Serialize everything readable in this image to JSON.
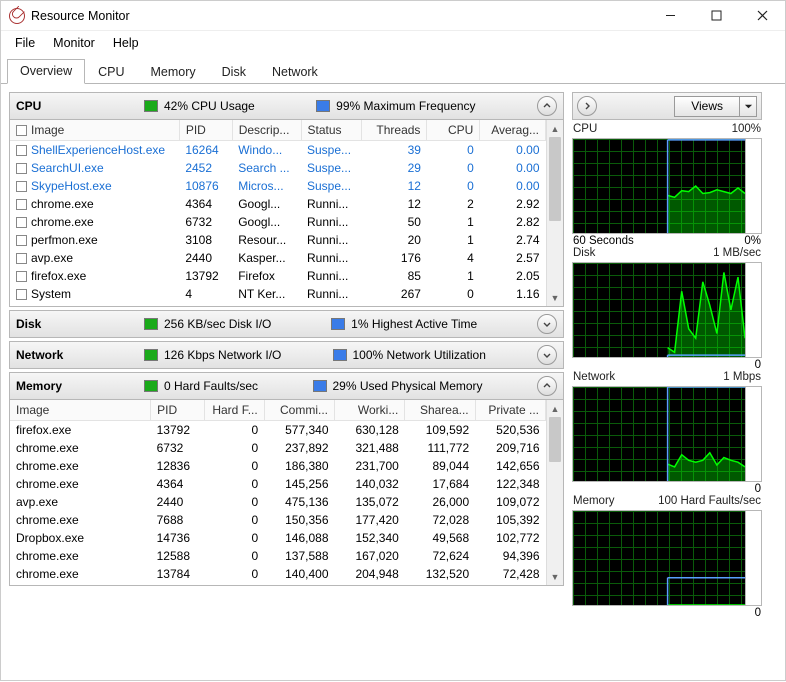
{
  "window": {
    "title": "Resource Monitor",
    "menu": [
      "File",
      "Monitor",
      "Help"
    ],
    "tabs": [
      "Overview",
      "CPU",
      "Memory",
      "Disk",
      "Network"
    ],
    "active_tab": 0,
    "views_label": "Views"
  },
  "sections": {
    "cpu": {
      "title": "CPU",
      "metric1": "42% CPU Usage",
      "metric2": "99% Maximum Frequency",
      "cols": [
        "Image",
        "PID",
        "Descrip...",
        "Status",
        "Threads",
        "CPU",
        "Averag..."
      ],
      "rows": [
        {
          "blue": true,
          "image": "ShellExperienceHost.exe",
          "pid": "16264",
          "desc": "Windo...",
          "status": "Suspe...",
          "threads": "39",
          "cpu": "0",
          "avg": "0.00"
        },
        {
          "blue": true,
          "image": "SearchUI.exe",
          "pid": "2452",
          "desc": "Search ...",
          "status": "Suspe...",
          "threads": "29",
          "cpu": "0",
          "avg": "0.00"
        },
        {
          "blue": true,
          "image": "SkypeHost.exe",
          "pid": "10876",
          "desc": "Micros...",
          "status": "Suspe...",
          "threads": "12",
          "cpu": "0",
          "avg": "0.00"
        },
        {
          "blue": false,
          "image": "chrome.exe",
          "pid": "4364",
          "desc": "Googl...",
          "status": "Runni...",
          "threads": "12",
          "cpu": "2",
          "avg": "2.92"
        },
        {
          "blue": false,
          "image": "chrome.exe",
          "pid": "6732",
          "desc": "Googl...",
          "status": "Runni...",
          "threads": "50",
          "cpu": "1",
          "avg": "2.82"
        },
        {
          "blue": false,
          "image": "perfmon.exe",
          "pid": "3108",
          "desc": "Resour...",
          "status": "Runni...",
          "threads": "20",
          "cpu": "1",
          "avg": "2.74"
        },
        {
          "blue": false,
          "image": "avp.exe",
          "pid": "2440",
          "desc": "Kasper...",
          "status": "Runni...",
          "threads": "176",
          "cpu": "4",
          "avg": "2.57"
        },
        {
          "blue": false,
          "image": "firefox.exe",
          "pid": "13792",
          "desc": "Firefox",
          "status": "Runni...",
          "threads": "85",
          "cpu": "1",
          "avg": "2.05"
        },
        {
          "blue": false,
          "image": "System",
          "pid": "4",
          "desc": "NT Ker...",
          "status": "Runni...",
          "threads": "267",
          "cpu": "0",
          "avg": "1.16"
        }
      ]
    },
    "disk": {
      "title": "Disk",
      "metric1": "256 KB/sec Disk I/O",
      "metric2": "1% Highest Active Time"
    },
    "network": {
      "title": "Network",
      "metric1": "126 Kbps Network I/O",
      "metric2": "100% Network Utilization"
    },
    "memory": {
      "title": "Memory",
      "metric1": "0 Hard Faults/sec",
      "metric2": "29% Used Physical Memory",
      "cols": [
        "Image",
        "PID",
        "Hard F...",
        "Commi...",
        "Worki...",
        "Sharea...",
        "Private ..."
      ],
      "rows": [
        {
          "image": "firefox.exe",
          "pid": "13792",
          "hf": "0",
          "commit": "577,340",
          "work": "630,128",
          "share": "109,592",
          "priv": "520,536"
        },
        {
          "image": "chrome.exe",
          "pid": "6732",
          "hf": "0",
          "commit": "237,892",
          "work": "321,488",
          "share": "111,772",
          "priv": "209,716"
        },
        {
          "image": "chrome.exe",
          "pid": "12836",
          "hf": "0",
          "commit": "186,380",
          "work": "231,700",
          "share": "89,044",
          "priv": "142,656"
        },
        {
          "image": "chrome.exe",
          "pid": "4364",
          "hf": "0",
          "commit": "145,256",
          "work": "140,032",
          "share": "17,684",
          "priv": "122,348"
        },
        {
          "image": "avp.exe",
          "pid": "2440",
          "hf": "0",
          "commit": "475,136",
          "work": "135,072",
          "share": "26,000",
          "priv": "109,072"
        },
        {
          "image": "chrome.exe",
          "pid": "7688",
          "hf": "0",
          "commit": "150,356",
          "work": "177,420",
          "share": "72,028",
          "priv": "105,392"
        },
        {
          "image": "Dropbox.exe",
          "pid": "14736",
          "hf": "0",
          "commit": "146,088",
          "work": "152,340",
          "share": "49,568",
          "priv": "102,772"
        },
        {
          "image": "chrome.exe",
          "pid": "12588",
          "hf": "0",
          "commit": "137,588",
          "work": "167,020",
          "share": "72,624",
          "priv": "94,396"
        },
        {
          "image": "chrome.exe",
          "pid": "13784",
          "hf": "0",
          "commit": "140,400",
          "work": "204,948",
          "share": "132,520",
          "priv": "72,428"
        }
      ]
    }
  },
  "graphs": {
    "g1": {
      "left": "CPU",
      "right": "100%",
      "foot_left": "60 Seconds",
      "foot_right": "0%"
    },
    "g2": {
      "left": "Disk",
      "right": "1 MB/sec",
      "foot_right": "0"
    },
    "g3": {
      "left": "Network",
      "right": "1 Mbps",
      "foot_right": "0"
    },
    "g4": {
      "left": "Memory",
      "right": "100 Hard Faults/sec",
      "foot_right": "0"
    }
  },
  "chart_data": [
    {
      "type": "line",
      "title": "CPU",
      "ylim": [
        0,
        100
      ],
      "xlabel": "60 Seconds",
      "blue_series": [
        99,
        99,
        99,
        99,
        99,
        99,
        99,
        99,
        99,
        99,
        99,
        99
      ],
      "green_series": [
        40,
        38,
        45,
        44,
        50,
        42,
        43,
        46,
        44,
        42,
        48,
        42
      ]
    },
    {
      "type": "line",
      "title": "Disk",
      "ylim": [
        0,
        1
      ],
      "ylabel": "MB/sec",
      "blue_series": [
        0.02,
        0.02,
        0.02,
        0.02,
        0.02,
        0.02,
        0.02,
        0.02,
        0.02,
        0.02,
        0.02,
        0.02
      ],
      "green_series": [
        0.1,
        0.05,
        0.7,
        0.3,
        0.2,
        0.8,
        0.55,
        0.25,
        0.9,
        0.5,
        0.85,
        0.2
      ]
    },
    {
      "type": "line",
      "title": "Network",
      "ylim": [
        0,
        1
      ],
      "ylabel": "Mbps",
      "blue_series": [
        1,
        1,
        1,
        1,
        1,
        1,
        1,
        1,
        1,
        1,
        1,
        1
      ],
      "green_series": [
        0.18,
        0.15,
        0.28,
        0.22,
        0.2,
        0.22,
        0.3,
        0.17,
        0.25,
        0.22,
        0.2,
        0.15
      ]
    },
    {
      "type": "line",
      "title": "Memory",
      "ylim": [
        0,
        100
      ],
      "ylabel": "Hard Faults/sec",
      "blue_series": [
        29,
        29,
        29,
        29,
        29,
        29,
        29,
        29,
        29,
        29,
        29,
        29
      ],
      "green_series": [
        0,
        0,
        0,
        0,
        0,
        0,
        0,
        0,
        0,
        0,
        0,
        0
      ]
    }
  ]
}
